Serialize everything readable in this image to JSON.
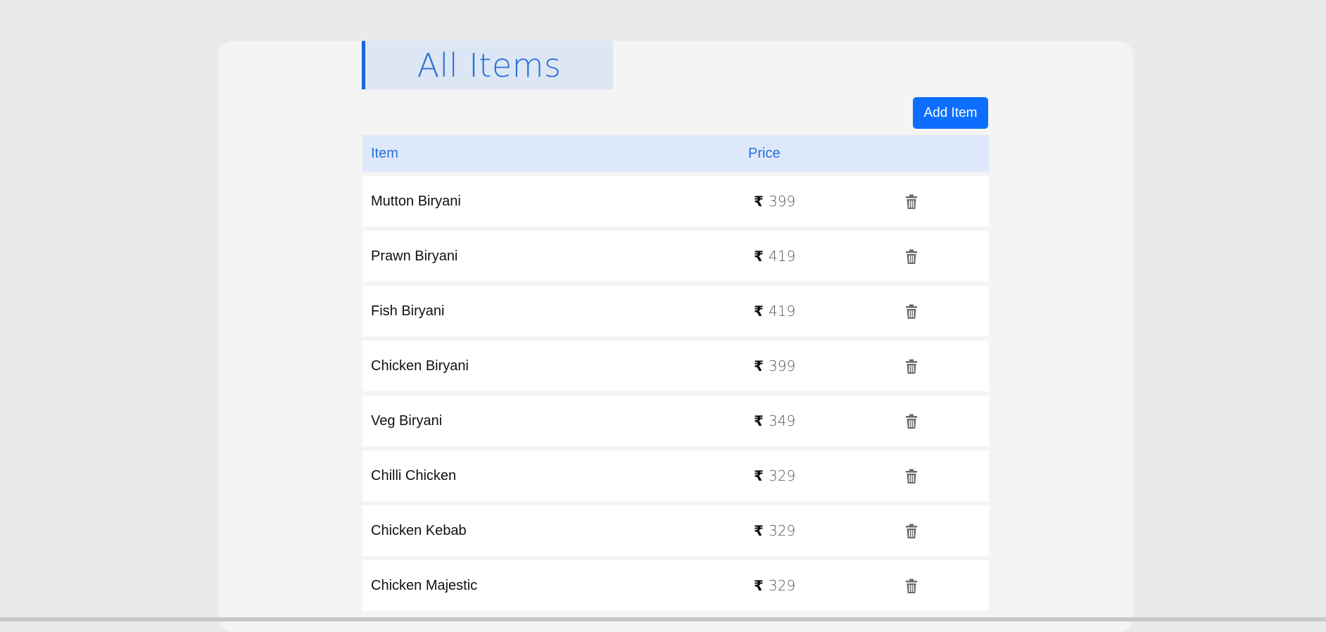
{
  "page": {
    "title": "All Items",
    "add_button_label": "Add Item"
  },
  "table": {
    "headers": {
      "item": "Item",
      "price": "Price"
    },
    "currency_symbol": "₹",
    "rows": [
      {
        "name": "Mutton Biryani",
        "price": "399"
      },
      {
        "name": "Prawn Biryani",
        "price": "419"
      },
      {
        "name": "Fish Biryani",
        "price": "419"
      },
      {
        "name": "Chicken Biryani",
        "price": "399"
      },
      {
        "name": "Veg Biryani",
        "price": "349"
      },
      {
        "name": "Chilli Chicken",
        "price": "329"
      },
      {
        "name": "Chicken Kebab",
        "price": "329"
      },
      {
        "name": "Chicken Majestic",
        "price": "329"
      }
    ],
    "row_action_icon": "trash-icon"
  },
  "colors": {
    "accent": "#0d6efd",
    "title_text": "#2a6fd8",
    "header_bg": "#dde9fb",
    "icon": "#6b6b6b"
  }
}
